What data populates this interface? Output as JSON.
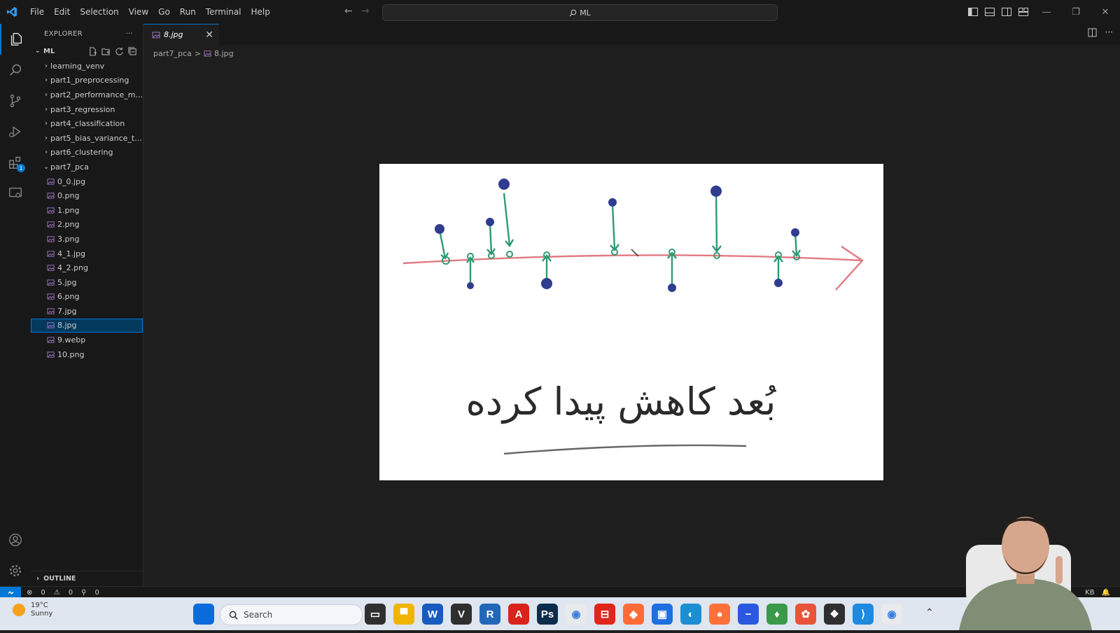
{
  "menu": [
    "File",
    "Edit",
    "Selection",
    "View",
    "Go",
    "Run",
    "Terminal",
    "Help"
  ],
  "command_center": {
    "text": "ML"
  },
  "explorer": {
    "title": "EXPLORER",
    "more": "···",
    "root": "ML",
    "folders": [
      "learning_venv",
      "part1_preprocessing",
      "part2_performance_m...",
      "part3_regression",
      "part4_classification",
      "part5_bias_variance_t...",
      "part6_clustering"
    ],
    "open_folder": "part7_pca",
    "files": [
      "0_0.jpg",
      "0.png",
      "1.png",
      "2.png",
      "3.png",
      "4_1.jpg",
      "4_2.png",
      "5.jpg",
      "6.png",
      "7.jpg",
      "8.jpg",
      "9.webp",
      "10.png"
    ],
    "selected_file": "8.jpg",
    "outline": "OUTLINE"
  },
  "tab": {
    "label": "8.jpg",
    "close": "✕"
  },
  "breadcrumb": {
    "folder": "part7_pca",
    "sep": ">",
    "file": "8.jpg"
  },
  "status": {
    "errors": "0",
    "warnings": "0",
    "ports": "0",
    "right_text": "KB"
  },
  "taskbar": {
    "temp": "19°C",
    "condition": "Sunny",
    "search_placeholder": "Search",
    "icons": [
      {
        "name": "windows-start",
        "glyph": "",
        "color": "#0a6cda"
      },
      {
        "name": "task-view",
        "glyph": "▭",
        "color": "#2f2f2f"
      },
      {
        "name": "file-explorer",
        "glyph": "▀",
        "color": "#f0b400"
      },
      {
        "name": "word",
        "glyph": "W",
        "color": "#185abd"
      },
      {
        "name": "vim",
        "glyph": "V",
        "color": "#2f2f2f"
      },
      {
        "name": "r-studio",
        "glyph": "R",
        "color": "#2268b8"
      },
      {
        "name": "acrobat",
        "glyph": "A",
        "color": "#d8241c"
      },
      {
        "name": "photoshop",
        "glyph": "Ps",
        "color": "#0c2c4c"
      },
      {
        "name": "chrome",
        "glyph": "◉",
        "color": "#e8eaed"
      },
      {
        "name": "pdf-reader",
        "glyph": "⊟",
        "color": "#e1251b"
      },
      {
        "name": "postman",
        "glyph": "◆",
        "color": "#ff6c37"
      },
      {
        "name": "app-blue",
        "glyph": "▣",
        "color": "#1f6fe0"
      },
      {
        "name": "edge",
        "glyph": "◐",
        "color": "#1b8fd1"
      },
      {
        "name": "firefox",
        "glyph": "●",
        "color": "#ff7139"
      },
      {
        "name": "app-minus",
        "glyph": "−",
        "color": "#2a58e0"
      },
      {
        "name": "app-leaf",
        "glyph": "♦",
        "color": "#3a9a4a"
      },
      {
        "name": "app-orange",
        "glyph": "✿",
        "color": "#e8543a"
      },
      {
        "name": "davinci",
        "glyph": "❖",
        "color": "#2f2f2f"
      },
      {
        "name": "vscode",
        "glyph": "⟩",
        "color": "#1f8ae0"
      },
      {
        "name": "chrome-profile",
        "glyph": "◉",
        "color": "#e8eaed"
      }
    ]
  },
  "drawing": {
    "caption": "بُعد کاهش پیدا کرده"
  }
}
